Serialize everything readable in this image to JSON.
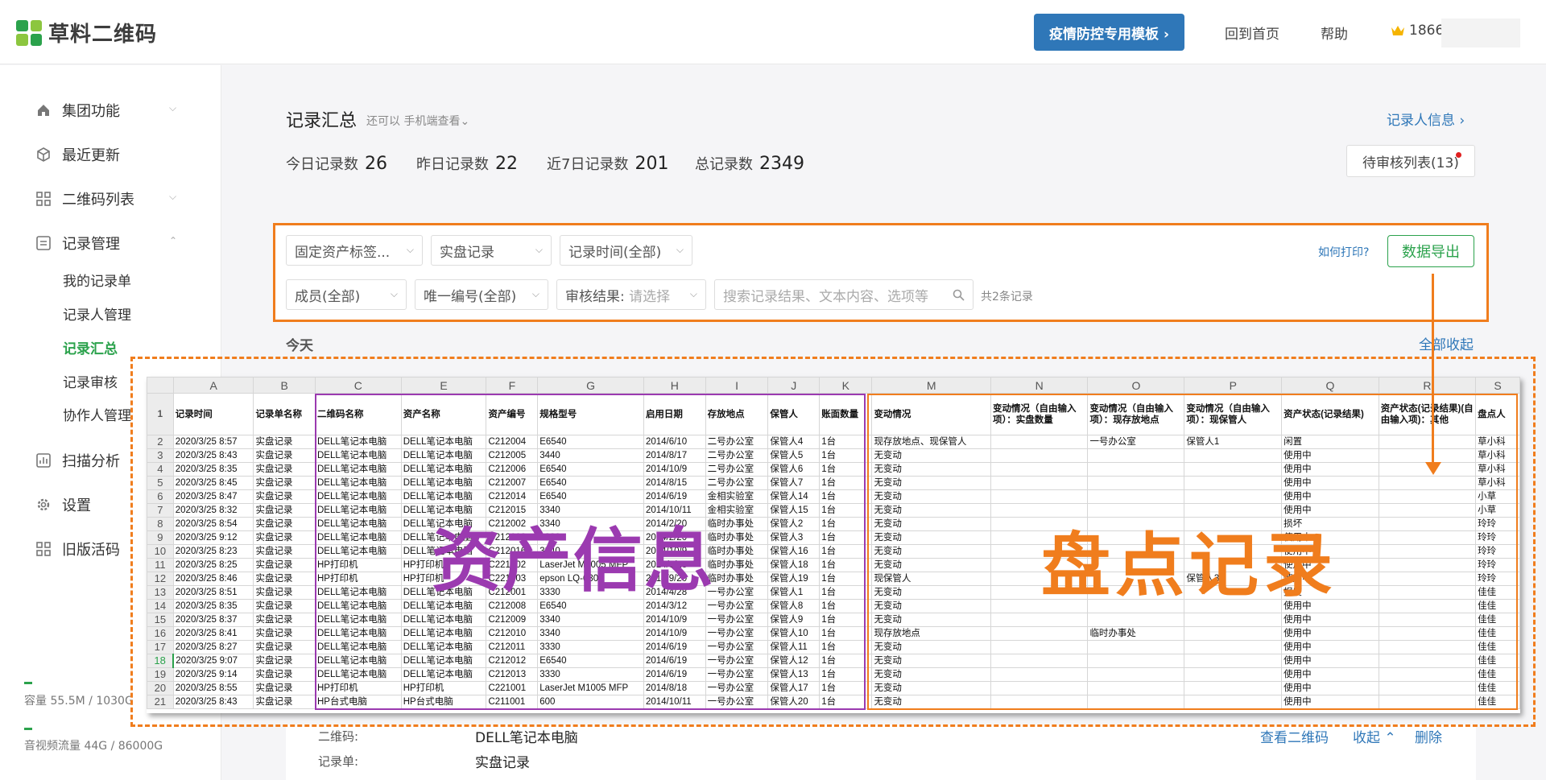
{
  "brand": {
    "name": "草料二维码",
    "colors": {
      "accent": "#2ba24c",
      "link": "#2f77b8",
      "annotation": "#f07d1d",
      "annotation2": "#9b3ab0"
    }
  },
  "header": {
    "promo": "疫情防控专用模板 ›",
    "home": "回到首页",
    "help": "帮助",
    "user": "1866"
  },
  "sidebar": {
    "items": [
      {
        "label": "集团功能",
        "icon": "home-icon"
      },
      {
        "label": "最近更新",
        "icon": "cube-icon"
      },
      {
        "label": "二维码列表",
        "icon": "grid-icon"
      },
      {
        "label": "记录管理",
        "icon": "form-icon"
      },
      {
        "label": "扫描分析",
        "icon": "bar-chart-icon"
      },
      {
        "label": "设置",
        "icon": "gear-icon"
      },
      {
        "label": "旧版活码",
        "icon": "grid-icon"
      }
    ],
    "subitems": [
      "我的记录单",
      "记录人管理",
      "记录汇总",
      "记录审核",
      "协作人管理"
    ],
    "storage": "容量 55.5M / 1030G",
    "traffic": "音视频流量 44G / 86000G"
  },
  "page": {
    "title": "记录汇总",
    "subtitle": "还可以 手机端查看⌄",
    "recorder_link": "记录人信息 ›",
    "stats": [
      {
        "label": "今日记录数",
        "value": "26"
      },
      {
        "label": "昨日记录数",
        "value": "22"
      },
      {
        "label": "近7日记录数",
        "value": "201"
      },
      {
        "label": "总记录数",
        "value": "2349"
      }
    ],
    "pending": "待审核列表(13)"
  },
  "filters": {
    "asset_tag": "固定资产标签...",
    "record_form": "实盘记录",
    "time": "记录时间(全部)",
    "member": "成员(全部)",
    "unique_id": "唯一编号(全部)",
    "audit_label": "审核结果:",
    "audit_placeholder": "请选择",
    "search_placeholder": "搜索记录结果、文本内容、选项等",
    "how_print": "如何打印?",
    "export": "数据导出",
    "count": "共2条记录"
  },
  "today": "今天",
  "collapse_all": "全部收起",
  "annotations": {
    "asset_info": "资产信息",
    "inventory": "盘点记录"
  },
  "sheet": {
    "col_letters": [
      "A",
      "B",
      "C",
      "E",
      "F",
      "G",
      "H",
      "I",
      "J",
      "K",
      "M",
      "N",
      "O",
      "P",
      "Q",
      "R",
      "S"
    ],
    "headers": [
      "记录时间",
      "记录单名称",
      "二维码名称",
      "资产名称",
      "资产编号",
      "规格型号",
      "启用日期",
      "存放地点",
      "保管人",
      "账面数量",
      "变动情况",
      "变动情况（自由输入项）：实盘数量",
      "变动情况（自由输入项）：现存放地点",
      "变动情况（自由输入项）：现保管人",
      "资产状态(记录结果)",
      "资产状态(记录结果)(自由输入项)：其他",
      "盘点人"
    ],
    "rows": [
      [
        "2020/3/25 8:57",
        "实盘记录",
        "DELL笔记本电脑",
        "DELL笔记本电脑",
        "C212004",
        "E6540",
        "2014/6/10",
        "二号办公室",
        "保管人4",
        "1台",
        "现存放地点、现保管人",
        "",
        "一号办公室",
        "保管人1",
        "闲置",
        "",
        "草小科"
      ],
      [
        "2020/3/25 8:43",
        "实盘记录",
        "DELL笔记本电脑",
        "DELL笔记本电脑",
        "C212005",
        "3440",
        "2014/8/17",
        "二号办公室",
        "保管人5",
        "1台",
        "无变动",
        "",
        "",
        "",
        "使用中",
        "",
        "草小科"
      ],
      [
        "2020/3/25 8:35",
        "实盘记录",
        "DELL笔记本电脑",
        "DELL笔记本电脑",
        "C212006",
        "E6540",
        "2014/10/9",
        "二号办公室",
        "保管人6",
        "1台",
        "无变动",
        "",
        "",
        "",
        "使用中",
        "",
        "草小科"
      ],
      [
        "2020/3/25 8:45",
        "实盘记录",
        "DELL笔记本电脑",
        "DELL笔记本电脑",
        "C212007",
        "E6540",
        "2014/8/15",
        "二号办公室",
        "保管人7",
        "1台",
        "无变动",
        "",
        "",
        "",
        "使用中",
        "",
        "草小科"
      ],
      [
        "2020/3/25 8:47",
        "实盘记录",
        "DELL笔记本电脑",
        "DELL笔记本电脑",
        "C212014",
        "E6540",
        "2014/6/19",
        "金相实验室",
        "保管人14",
        "1台",
        "无变动",
        "",
        "",
        "",
        "使用中",
        "",
        "小草"
      ],
      [
        "2020/3/25 8:32",
        "实盘记录",
        "DELL笔记本电脑",
        "DELL笔记本电脑",
        "C212015",
        "3340",
        "2014/10/11",
        "金相实验室",
        "保管人15",
        "1台",
        "无变动",
        "",
        "",
        "",
        "使用中",
        "",
        "小草"
      ],
      [
        "2020/3/25 8:54",
        "实盘记录",
        "DELL笔记本电脑",
        "DELL笔记本电脑",
        "C212002",
        "3340",
        "2014/2/20",
        "临时办事处",
        "保管人2",
        "1台",
        "无变动",
        "",
        "",
        "",
        "损坏",
        "",
        "玲玲"
      ],
      [
        "2020/3/25 9:12",
        "实盘记录",
        "DELL笔记本电脑",
        "DELL笔记本电脑",
        "C212003",
        "3330",
        "2014/2/20",
        "临时办事处",
        "保管人3",
        "1台",
        "无变动",
        "",
        "",
        "",
        "使用中",
        "",
        "玲玲"
      ],
      [
        "2020/3/25 8:23",
        "实盘记录",
        "DELL笔记本电脑",
        "DELL笔记本电脑",
        "C212016",
        "3340",
        "2014/10/9",
        "临时办事处",
        "保管人16",
        "1台",
        "无变动",
        "",
        "",
        "",
        "使用中",
        "",
        "玲玲"
      ],
      [
        "2020/3/25 8:25",
        "实盘记录",
        "HP打印机",
        "HP打印机",
        "C221002",
        "LaserJet M1005 MFP",
        "2014/8/18",
        "临时办事处",
        "保管人18",
        "1台",
        "无变动",
        "",
        "",
        "",
        "使用中",
        "",
        "玲玲"
      ],
      [
        "2020/3/25 8:46",
        "实盘记录",
        "HP打印机",
        "HP打印机",
        "C221003",
        "epson LQ-630K",
        "2014/9/20",
        "临时办事处",
        "保管人19",
        "1台",
        "现保管人",
        "",
        "",
        "保管人3",
        "使用中",
        "",
        "玲玲"
      ],
      [
        "2020/3/25 8:51",
        "实盘记录",
        "DELL笔记本电脑",
        "DELL笔记本电脑",
        "C212001",
        "3330",
        "2014/4/28",
        "一号办公室",
        "保管人1",
        "1台",
        "无变动",
        "",
        "",
        "",
        "报废",
        "",
        "佳佳"
      ],
      [
        "2020/3/25 8:35",
        "实盘记录",
        "DELL笔记本电脑",
        "DELL笔记本电脑",
        "C212008",
        "E6540",
        "2014/3/12",
        "一号办公室",
        "保管人8",
        "1台",
        "无变动",
        "",
        "",
        "",
        "使用中",
        "",
        "佳佳"
      ],
      [
        "2020/3/25 8:37",
        "实盘记录",
        "DELL笔记本电脑",
        "DELL笔记本电脑",
        "C212009",
        "3340",
        "2014/10/9",
        "一号办公室",
        "保管人9",
        "1台",
        "无变动",
        "",
        "",
        "",
        "使用中",
        "",
        "佳佳"
      ],
      [
        "2020/3/25 8:41",
        "实盘记录",
        "DELL笔记本电脑",
        "DELL笔记本电脑",
        "C212010",
        "3340",
        "2014/10/9",
        "一号办公室",
        "保管人10",
        "1台",
        "现存放地点",
        "",
        "临时办事处",
        "",
        "使用中",
        "",
        "佳佳"
      ],
      [
        "2020/3/25 8:27",
        "实盘记录",
        "DELL笔记本电脑",
        "DELL笔记本电脑",
        "C212011",
        "3330",
        "2014/6/19",
        "一号办公室",
        "保管人11",
        "1台",
        "无变动",
        "",
        "",
        "",
        "使用中",
        "",
        "佳佳"
      ],
      [
        "2020/3/25 9:07",
        "实盘记录",
        "DELL笔记本电脑",
        "DELL笔记本电脑",
        "C212012",
        "E6540",
        "2014/6/19",
        "一号办公室",
        "保管人12",
        "1台",
        "无变动",
        "",
        "",
        "",
        "使用中",
        "",
        "佳佳"
      ],
      [
        "2020/3/25 9:14",
        "实盘记录",
        "DELL笔记本电脑",
        "DELL笔记本电脑",
        "C212013",
        "3330",
        "2014/6/19",
        "一号办公室",
        "保管人13",
        "1台",
        "无变动",
        "",
        "",
        "",
        "使用中",
        "",
        "佳佳"
      ],
      [
        "2020/3/25 8:55",
        "实盘记录",
        "HP打印机",
        "HP打印机",
        "C221001",
        "LaserJet M1005 MFP",
        "2014/8/18",
        "一号办公室",
        "保管人17",
        "1台",
        "无变动",
        "",
        "",
        "",
        "使用中",
        "",
        "佳佳"
      ],
      [
        "2020/3/25 8:43",
        "实盘记录",
        "HP台式电脑",
        "HP台式电脑",
        "C211001",
        "600",
        "2014/10/11",
        "一号办公室",
        "保管人20",
        "1台",
        "无变动",
        "",
        "",
        "",
        "使用中",
        "",
        "佳佳"
      ]
    ]
  },
  "detail": {
    "qr_label": "二维码:",
    "qr_value": "DELL笔记本电脑",
    "form_label": "记录单:",
    "form_value": "实盘记录",
    "view_qr": "查看二维码",
    "collapse": "收起 ⌃",
    "delete": "删除"
  }
}
